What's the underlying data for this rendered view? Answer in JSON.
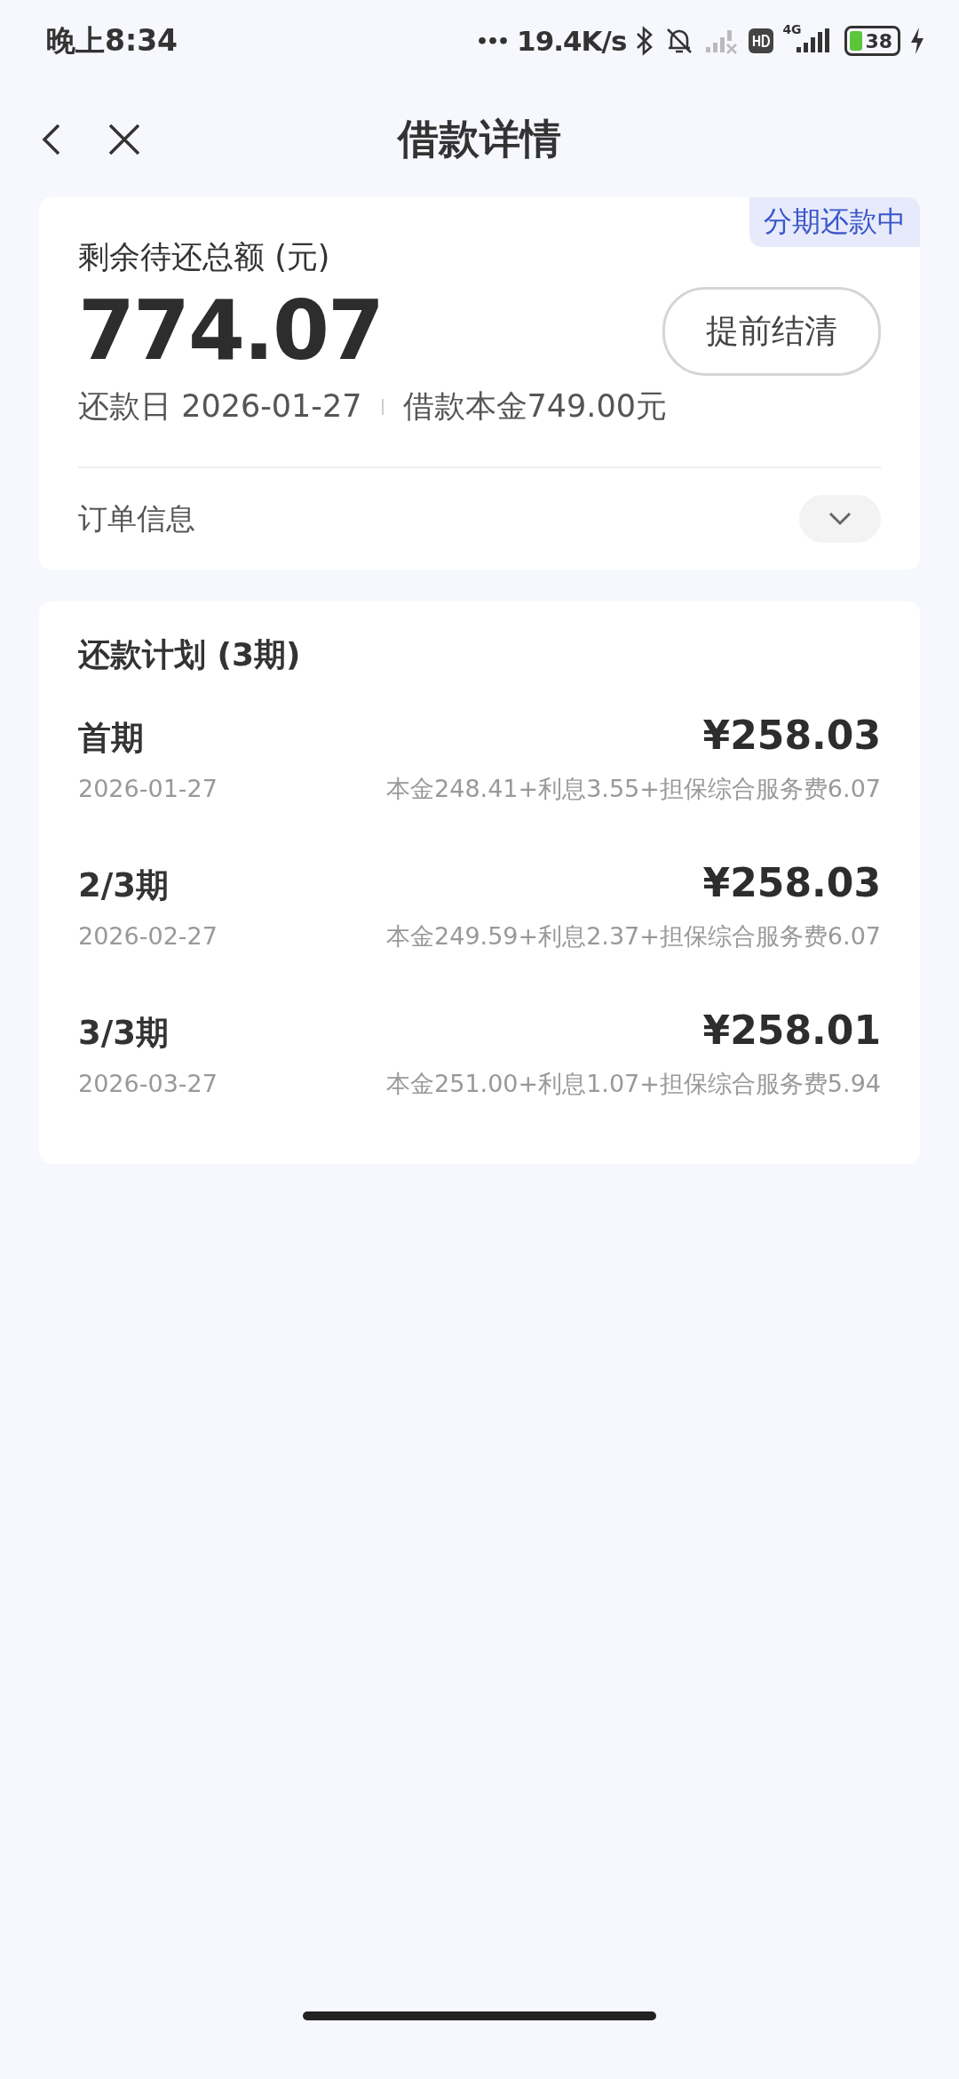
{
  "status_bar": {
    "time": "晚上8:34",
    "dots": "•••",
    "speed": "19.4K/s",
    "network": "4G",
    "battery": "38"
  },
  "header": {
    "title": "借款详情"
  },
  "summary": {
    "badge": "分期还款中",
    "label": "剩余待还总额 (元)",
    "amount": "774.07",
    "button": "提前结清",
    "due_date": "还款日 2026-01-27",
    "principal": "借款本金749.00元",
    "order_info": "订单信息",
    "expanded": false
  },
  "plan": {
    "title": "还款计划 (3期)",
    "rows": [
      {
        "period": "首期",
        "amount": "¥258.03",
        "date": "2026-01-27",
        "detail": "本金248.41+利息3.55+担保综合服务费6.07"
      },
      {
        "period": "2/3期",
        "amount": "¥258.03",
        "date": "2026-02-27",
        "detail": "本金249.59+利息2.37+担保综合服务费6.07"
      },
      {
        "period": "3/3期",
        "amount": "¥258.01",
        "date": "2026-03-27",
        "detail": "本金251.00+利息1.07+担保综合服务费5.94"
      }
    ]
  }
}
